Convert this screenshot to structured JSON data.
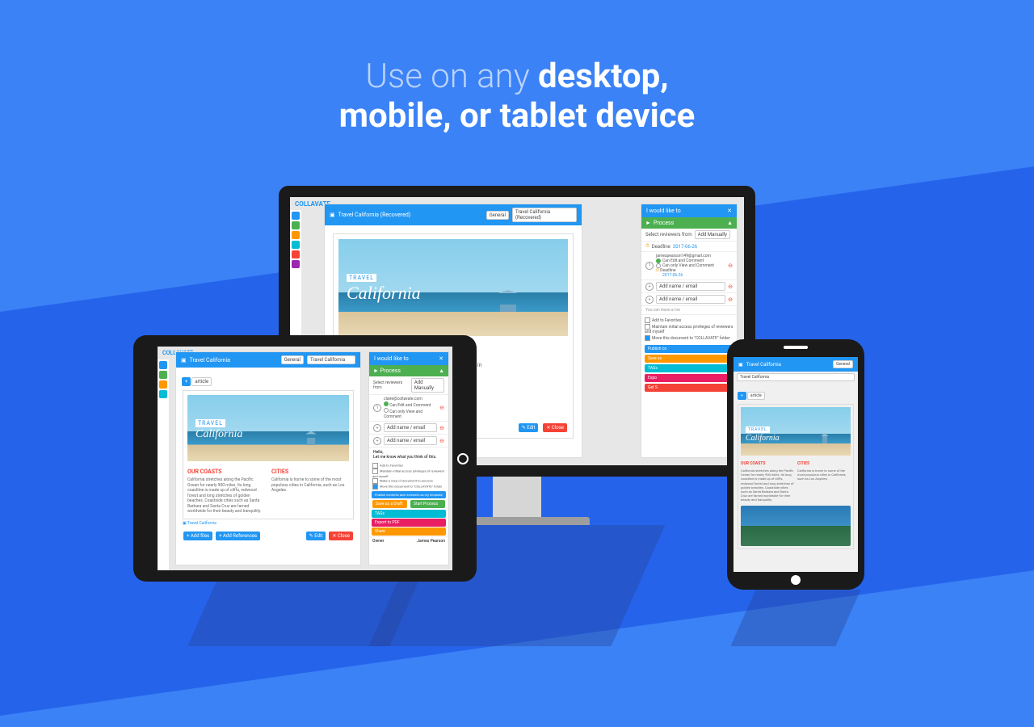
{
  "headline": {
    "prefix": "Use on any ",
    "bold1": "desktop,",
    "line2": "mobile, or tablet device"
  },
  "app": {
    "brand": "COLLAVATE",
    "doc_title": "Travel California",
    "doc_title_recovered": "Travel California (Recovered)",
    "category": "General",
    "article_label": "article",
    "hero": {
      "label_top": "TRAVEL",
      "label_script": "California"
    },
    "sections": {
      "our_coasts": "OUR COASTS",
      "cities": "CITIES",
      "coasts_body": "California stretches along the Pacific Ocean for nearly 900 miles. Its long coastline is made up of cliffs, redwood forest and long stretches of golden beaches. Coastside cities such as Santa Barbara and Santa Cruz are famed worldwide for their beauty and tranquility.",
      "cities_body": "California is home to some of the most populous cities in California, such as Los Angeles."
    },
    "message": {
      "greeting": "Hello,",
      "body": "Let me know what you think of this."
    },
    "buttons": {
      "add_files": "+ Add files",
      "add_references": "+ Add References",
      "edit": "✎ Edit",
      "close": "✕ Close",
      "publish": "Publish contents and reviewers as my template",
      "save_draft": "Save as a Draft",
      "start_process": "Start Process",
      "save_as": "Save as",
      "get_s": "Get S",
      "publish_co": "Publish co",
      "tags": "TAGs",
      "export_pdf": "Export to PDF",
      "expo": "Expo",
      "share": "Share"
    },
    "panel": {
      "title": "I would like to",
      "process": "Process",
      "select_reviewers": "Select reviewers from",
      "add_manually": "Add Manually",
      "deadline_label": "Deadline",
      "deadline_date": "2017-06-26",
      "reviewer_email": "jamespearson149@gmail.com",
      "reviewer_email2": "claire@collavate.com",
      "can_edit": "Can Edit and Comment",
      "can_view": "Can only View and Comment",
      "add_name": "Add name / email",
      "you_can": "You can leave a me",
      "options": {
        "add_fav": "Add to Favorites",
        "maintain": "Maintain initial access privileges of reviewers and myself",
        "make_copy": "Make a copy of document to process",
        "move_doc": "Move this document to \"COLLAVATE\" folder"
      }
    },
    "owner_label": "Owner",
    "owner_name": "James Pearson"
  }
}
